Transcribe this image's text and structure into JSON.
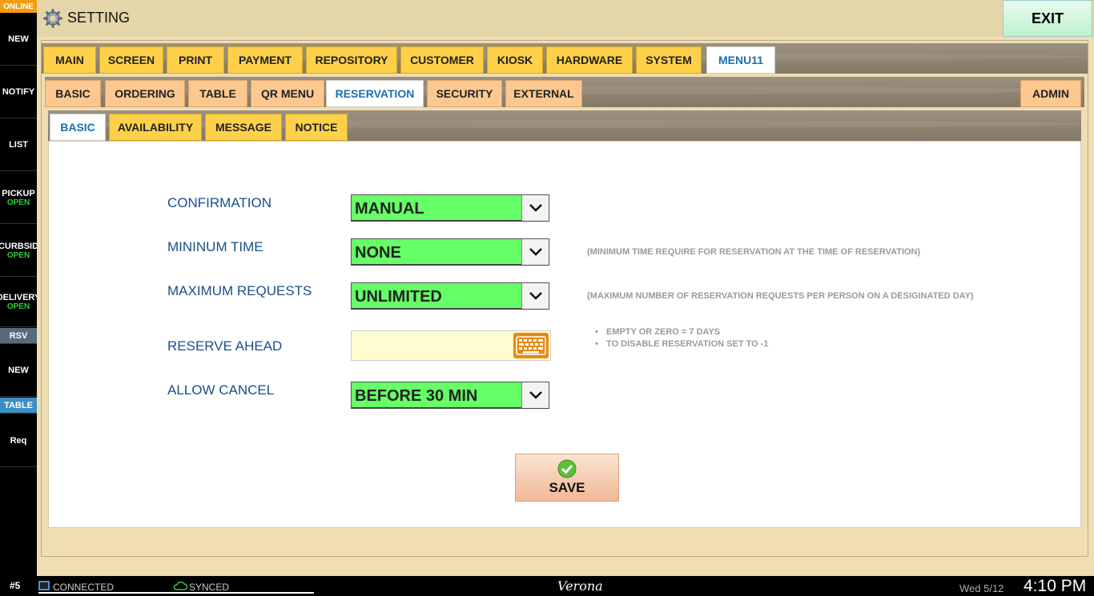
{
  "sidebar": {
    "online": "ONLINE",
    "items": [
      {
        "label": "NEW",
        "sub": ""
      },
      {
        "label": "NOTIFY",
        "sub": ""
      },
      {
        "label": "LIST",
        "sub": ""
      },
      {
        "label": "PICKUP",
        "sub": "OPEN"
      },
      {
        "label": "CURBSID",
        "sub": "OPEN"
      },
      {
        "label": "DELIVERY",
        "sub": "OPEN"
      }
    ],
    "rsv": "RSV",
    "new2": "NEW",
    "table": "TABLE",
    "req": "Req"
  },
  "header": {
    "title": "SETTING",
    "exit_label": "EXIT"
  },
  "tabs_main": [
    "MAIN",
    "SCREEN",
    "PRINT",
    "PAYMENT",
    "REPOSITORY",
    "CUSTOMER",
    "KIOSK",
    "HARDWARE",
    "SYSTEM",
    "MENU11"
  ],
  "tabs_sub": [
    "BASIC",
    "ORDERING",
    "TABLE",
    "QR MENU",
    "RESERVATION",
    "SECURITY",
    "EXTERNAL"
  ],
  "tab_admin": "ADMIN",
  "tabs_inner": [
    "BASIC",
    "AVAILABILITY",
    "MESSAGE",
    "NOTICE"
  ],
  "form": {
    "confirmation": {
      "label": "CONFIRMATION",
      "value": "MANUAL"
    },
    "minimum_time": {
      "label": "MININUM TIME",
      "value": "NONE",
      "hint": "(MINIMUM TIME REQUIRE FOR RESERVATION AT THE TIME OF RESERVATION)"
    },
    "maximum_requests": {
      "label": "MAXIMUM REQUESTS",
      "value": "UNLIMITED",
      "hint": "(MAXIMUM NUMBER OF RESERVATION REQUESTS PER PERSON ON A DESIGINATED DAY)"
    },
    "reserve_ahead": {
      "label": "RESERVE AHEAD",
      "value": "",
      "notes": [
        "EMPTY OR ZERO = 7 DAYS",
        "TO DISABLE RESERVATION SET TO -1"
      ]
    },
    "allow_cancel": {
      "label": "ALLOW CANCEL",
      "value": "BEFORE 30 MIN"
    }
  },
  "save_label": "SAVE",
  "status": {
    "station": "#5",
    "connection": "CONNECTED",
    "sync": "SYNCED",
    "brand": "Verona",
    "date": "Wed 5/12",
    "time": "4:10 PM"
  },
  "colors": {
    "tab_yellow": "#ffd04a",
    "tab_peach": "#fcc88f",
    "dropdown_green": "#66ff66",
    "label_blue": "#1b4f8a",
    "online_orange": "#f39c12",
    "open_green": "#2ecc40"
  }
}
